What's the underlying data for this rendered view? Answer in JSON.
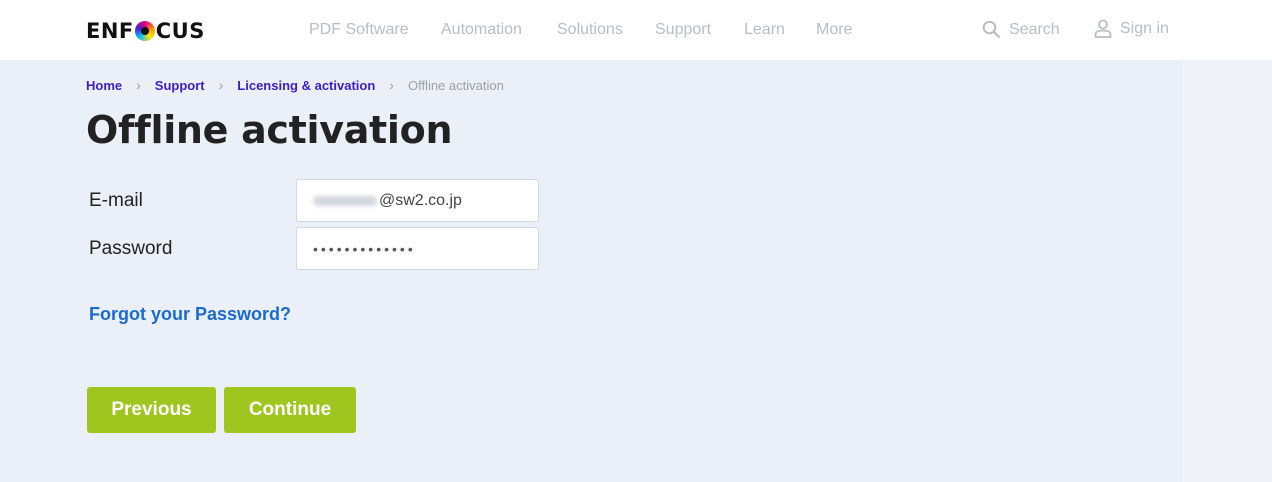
{
  "header": {
    "logo_text_left": "ENF",
    "logo_text_right": "CUS",
    "nav": [
      {
        "label": "PDF Software"
      },
      {
        "label": "Automation"
      },
      {
        "label": "Solutions"
      },
      {
        "label": "Support"
      },
      {
        "label": "Learn"
      },
      {
        "label": "More"
      }
    ],
    "search_label": "Search",
    "signin_label": "Sign in"
  },
  "breadcrumb": {
    "items": [
      {
        "label": "Home"
      },
      {
        "label": "Support"
      },
      {
        "label": "Licensing & activation"
      }
    ],
    "current": "Offline activation"
  },
  "page_title": "Offline activation",
  "form": {
    "email_label": "E-mail",
    "email_value": "@sw2.co.jp",
    "password_label": "Password",
    "password_value": "•••••••••••••",
    "forgot_link": "Forgot your Password?"
  },
  "buttons": {
    "previous": "Previous",
    "continue": "Continue"
  },
  "colors": {
    "accent_green": "#9ec61e",
    "link_purple": "#3a1fc9",
    "link_blue": "#1a6bd1",
    "main_bg": "#ebf0f8"
  }
}
